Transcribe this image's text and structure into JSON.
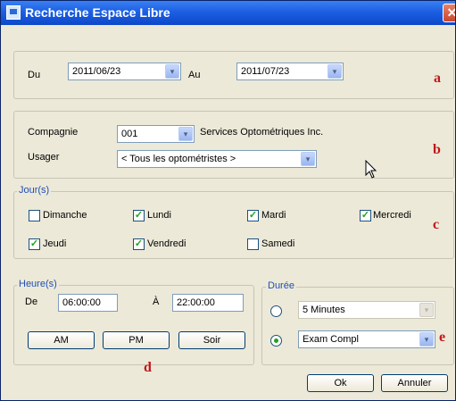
{
  "window": {
    "title": "Recherche Espace Libre",
    "close_glyph": "✕"
  },
  "dates": {
    "du_label": "Du",
    "du_value": "2011/06/23",
    "au_label": "Au",
    "au_value": "2011/07/23"
  },
  "company": {
    "compagnie_label": "Compagnie",
    "compagnie_value": "001",
    "compagnie_name": "Services Optométriques Inc.",
    "usager_label": "Usager",
    "usager_value": "< Tous les optométristes >"
  },
  "days": {
    "legend": "Jour(s)",
    "items": [
      {
        "label": "Dimanche",
        "checked": false
      },
      {
        "label": "Lundi",
        "checked": true
      },
      {
        "label": "Mardi",
        "checked": true
      },
      {
        "label": "Mercredi",
        "checked": true
      },
      {
        "label": "Jeudi",
        "checked": true
      },
      {
        "label": "Vendredi",
        "checked": true
      },
      {
        "label": "Samedi",
        "checked": false
      }
    ]
  },
  "hours": {
    "legend": "Heure(s)",
    "de_label": "De",
    "de_value": "06:00:00",
    "a_label": "À",
    "a_value": "22:00:00",
    "am_label": "AM",
    "pm_label": "PM",
    "soir_label": "Soir"
  },
  "duration": {
    "legend": "Durée",
    "option1_value": "5 Minutes",
    "option1_selected": false,
    "option2_value": "Exam Compl",
    "option2_selected": true
  },
  "actions": {
    "ok_label": "Ok",
    "cancel_label": "Annuler"
  },
  "annotations": {
    "a": "a",
    "b": "b",
    "c": "c",
    "d": "d",
    "e": "e"
  },
  "icons": {
    "check": "✓",
    "dropdown": "▾",
    "cursor": "cursor-arrow-icon"
  },
  "colors": {
    "title_bar": "#1c5fe2",
    "dialog_bg": "#ece9d8",
    "legend_text": "#1f4fb5",
    "annotation": "#c0181a",
    "check": "#21a121"
  }
}
